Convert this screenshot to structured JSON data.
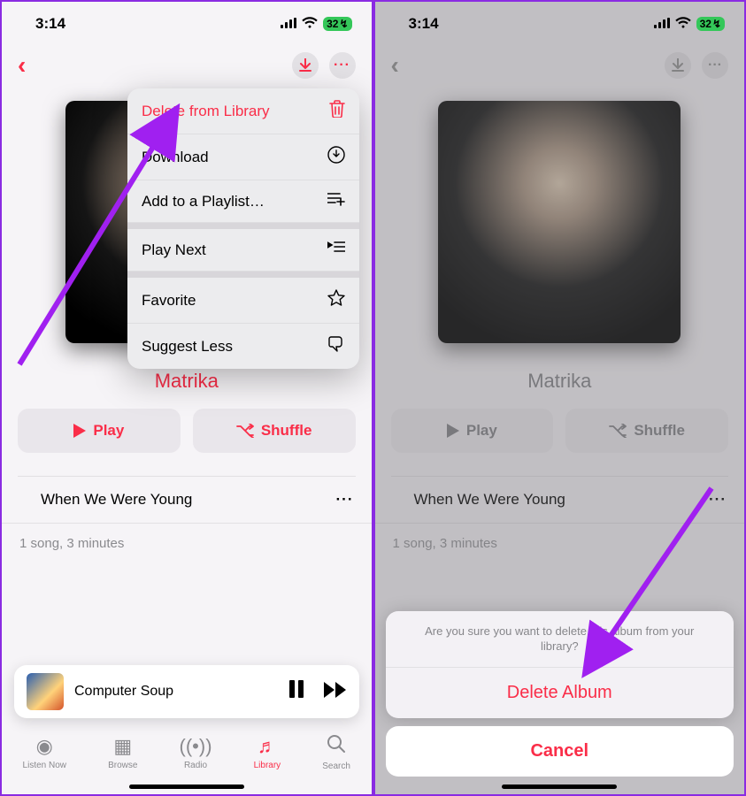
{
  "status": {
    "time": "3:14",
    "battery": "32",
    "charging_glyph": "↯"
  },
  "topbar": {
    "back_icon": "‹"
  },
  "album": {
    "title": "Matrika"
  },
  "buttons": {
    "play": "Play",
    "shuffle": "Shuffle"
  },
  "track": {
    "title": "When We Were Young"
  },
  "meta": {
    "text": "1 song, 3 minutes"
  },
  "now_playing": {
    "title": "Computer Soup"
  },
  "tabs": {
    "listen": "Listen Now",
    "browse": "Browse",
    "radio": "Radio",
    "library": "Library",
    "search": "Search"
  },
  "context_menu": {
    "delete": "Delete from Library",
    "download": "Download",
    "add_playlist": "Add to a Playlist…",
    "play_next": "Play Next",
    "favorite": "Favorite",
    "suggest_less": "Suggest Less"
  },
  "action_sheet": {
    "message": "Are you sure you want to delete this album from your library?",
    "delete": "Delete Album",
    "cancel": "Cancel"
  }
}
